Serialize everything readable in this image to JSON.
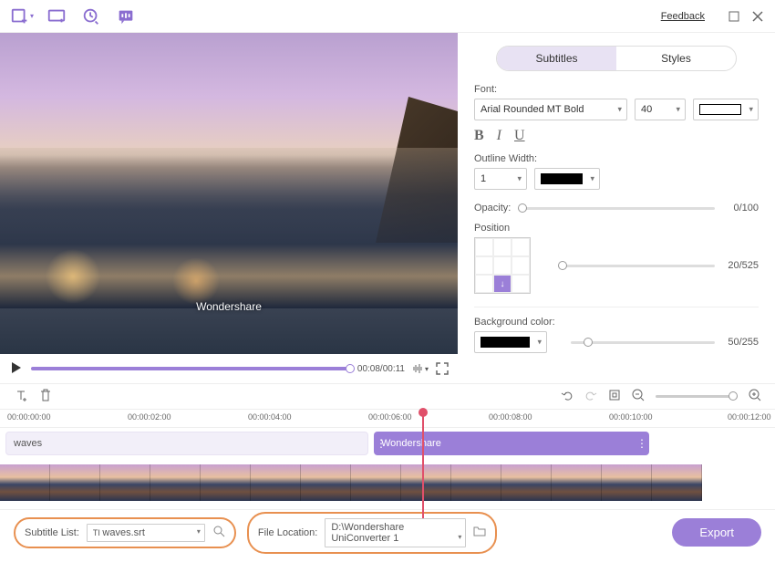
{
  "topbar": {
    "feedback": "Feedback"
  },
  "tabs": {
    "subtitles": "Subtitles",
    "styles": "Styles"
  },
  "panel": {
    "font_label": "Font:",
    "font_value": "Arial Rounded MT Bold",
    "size_value": "40",
    "outline_label": "Outline Width:",
    "outline_value": "1",
    "opacity_label": "Opacity:",
    "opacity_value": "0/100",
    "position_label": "Position",
    "position_value": "20/525",
    "bg_label": "Background color:",
    "bg_value": "50/255"
  },
  "preview": {
    "watermark": "Wondershare",
    "time": "00:08/00:11"
  },
  "timeline": {
    "ticks": [
      "00:00:00:00",
      "00:00:02:00",
      "00:00:04:00",
      "00:00:06:00",
      "00:00:08:00",
      "00:00:10:00",
      "00:00:12:00"
    ],
    "clip_a": "waves",
    "clip_b": "Wondershare"
  },
  "bottom": {
    "sub_label": "Subtitle List:",
    "sub_file": "waves.srt",
    "loc_label": "File Location:",
    "loc_path": "D:\\Wondershare UniConverter 1",
    "export": "Export"
  }
}
